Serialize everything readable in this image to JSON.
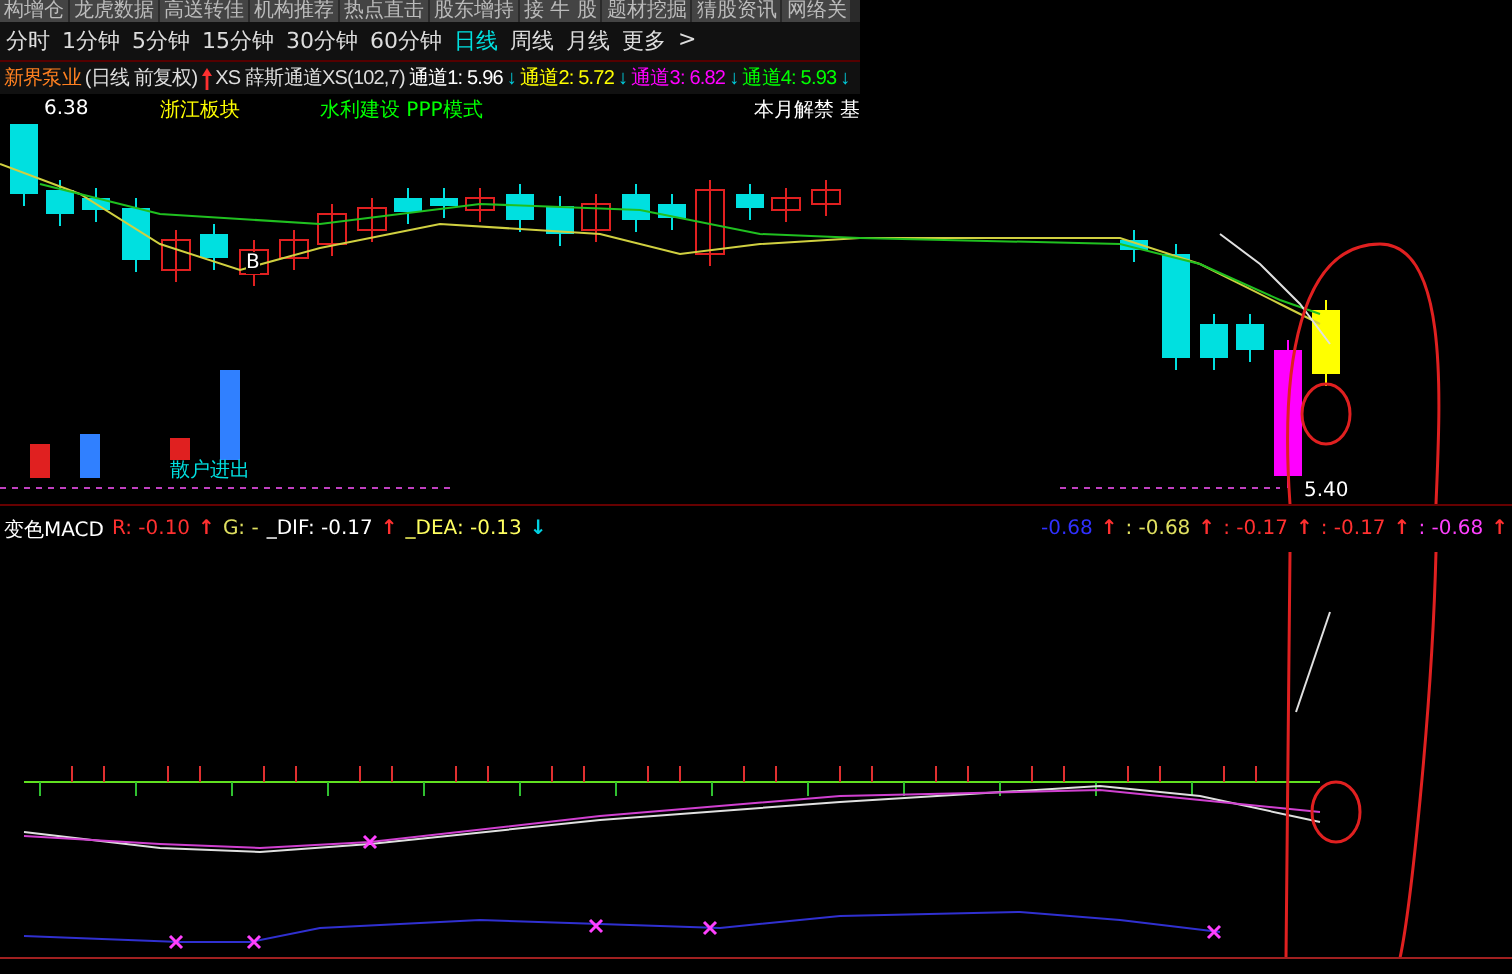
{
  "menu_bar": {
    "items": [
      "构增仓",
      "龙虎数据",
      "高送转佳",
      "机构推荐",
      "热点直击",
      "股东增持",
      "接 牛 股",
      "题材挖掘",
      "猜股资讯",
      "网络关"
    ]
  },
  "period_bar": {
    "items": [
      {
        "label": "分时",
        "selected": false
      },
      {
        "label": "1分钟",
        "selected": false
      },
      {
        "label": "5分钟",
        "selected": false
      },
      {
        "label": "15分钟",
        "selected": false
      },
      {
        "label": "30分钟",
        "selected": false
      },
      {
        "label": "60分钟",
        "selected": false
      },
      {
        "label": "日线",
        "selected": true
      },
      {
        "label": "周线",
        "selected": false
      },
      {
        "label": "月线",
        "selected": false
      },
      {
        "label": "更多",
        "selected": false
      },
      {
        "label": ">",
        "selected": false
      }
    ]
  },
  "info_line": {
    "stock_name": "新界泵业",
    "mode": "(日线 前复权)",
    "indicator": "XS 薛斯通道XS(102,7)",
    "channels": [
      {
        "label": "通道1: 5.96",
        "color": "#ffffff",
        "arrow": "↓",
        "rising": false
      },
      {
        "label": "通道2: 5.72",
        "color": "#ffff00",
        "arrow": "↓",
        "rising": false
      },
      {
        "label": "通道3: 6.82",
        "color": "#ff00ff",
        "arrow": "↓",
        "rising": false
      },
      {
        "label": "通道4: 5.93",
        "color": "#00ff00",
        "arrow": "↓",
        "rising": false
      }
    ]
  },
  "tags": [
    {
      "label": "浙江板块",
      "color": "#ffff00"
    },
    {
      "label": "水利建设 PPP模式",
      "color": "#00ff00"
    },
    {
      "label": "本月解禁 基",
      "color": "#ffffff"
    }
  ],
  "price_chart": {
    "price_label": "6.38",
    "signal_label": "B",
    "low_price": "5.40",
    "volume_label": "散户进出"
  },
  "macd_panel": {
    "title": "变色MACD",
    "values": [
      {
        "text": "R: -0.10",
        "color": "#ff3030",
        "arrow": "↑",
        "rising": true
      },
      {
        "text": "G: -",
        "color": "#e0e060"
      },
      {
        "text": "_DIF: -0.17",
        "color": "#ffffff",
        "arrow": "↑",
        "rising": true
      },
      {
        "text": "_DEA: -0.13",
        "color": "#ffff60",
        "arrow": "↓",
        "rising": false
      }
    ],
    "right_values": [
      {
        "text": "-0.68",
        "color": "#3030ff",
        "arrow": "↑",
        "rising": true
      },
      {
        "text": ": -0.68",
        "color": "#e0e060",
        "arrow": "↑",
        "rising": true
      },
      {
        "text": ": -0.17",
        "color": "#ff3030",
        "arrow": "↑",
        "rising": true
      },
      {
        "text": ": -0.17",
        "color": "#ff3030",
        "arrow": "↑",
        "rising": true
      },
      {
        "text": ": -0.68",
        "color": "#ff40ff",
        "arrow": "↑",
        "rising": true
      }
    ]
  }
}
